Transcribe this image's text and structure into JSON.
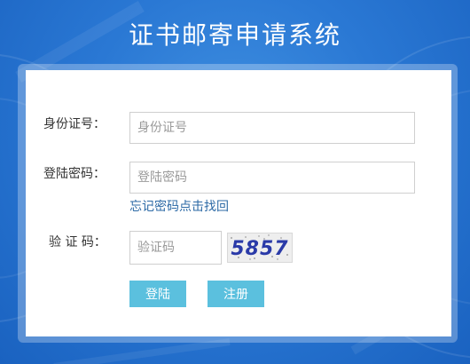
{
  "page": {
    "title": "证书邮寄申请系统"
  },
  "form": {
    "id_number": {
      "label": "身份证号：",
      "placeholder": "身份证号",
      "value": ""
    },
    "password": {
      "label": "登陆密码：",
      "placeholder": "登陆密码",
      "value": ""
    },
    "forgot_password_link": "忘记密码点击找回",
    "captcha": {
      "label": "验 证 码：",
      "placeholder": "验证码",
      "value": "",
      "image_text": "5857"
    },
    "login_button": "登陆",
    "register_button": "注册"
  },
  "colors": {
    "background": "#2a78d4",
    "button": "#5bc0de",
    "link": "#2d6aa6",
    "captcha_text": "#2a3aa8"
  }
}
